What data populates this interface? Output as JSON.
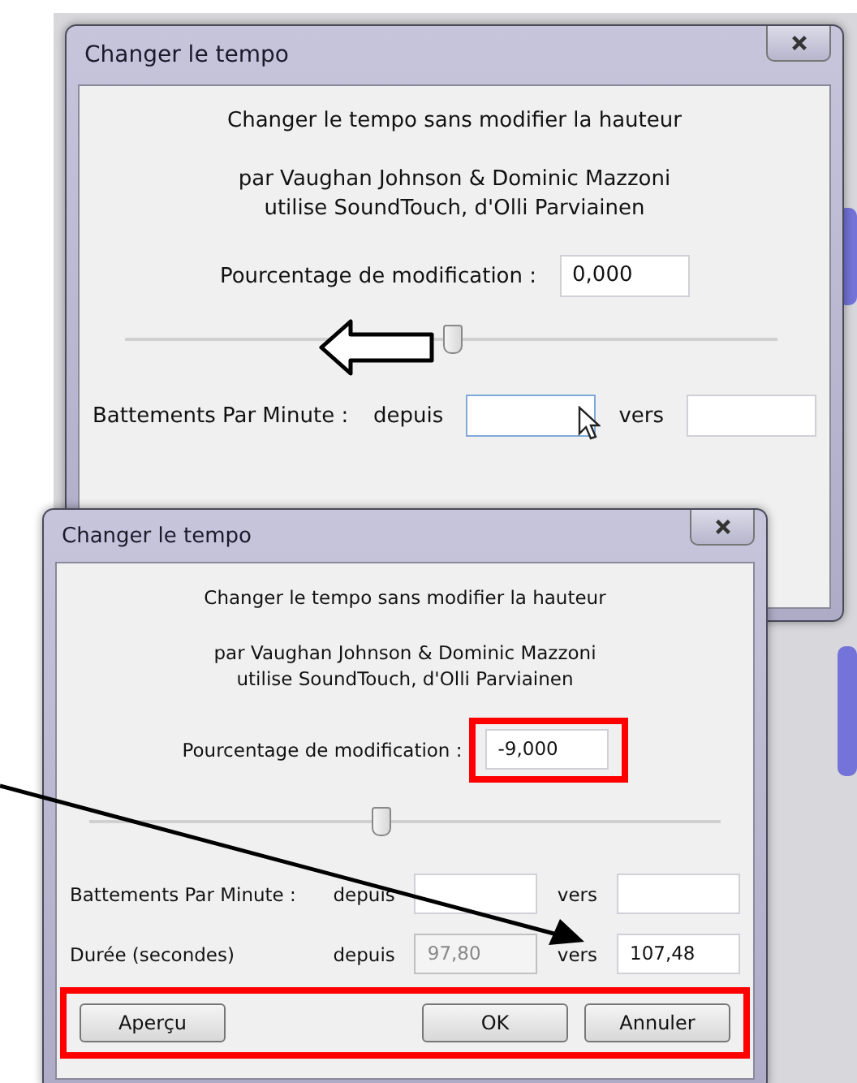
{
  "windows": [
    {
      "title": "Changer le tempo",
      "heading": "Changer le tempo sans modifier la hauteur",
      "credits": [
        "par Vaughan Johnson & Dominic Mazzoni",
        "utilise SoundTouch, d'Olli Parviainen"
      ],
      "percent": {
        "label": "Pourcentage de modification :",
        "value": "0,000",
        "highlighted": false
      },
      "slider": {
        "level": 0.5
      },
      "rows": [
        {
          "label": "Battements Par Minute :",
          "fields": [
            {
              "label": "depuis",
              "focused": true,
              "disabled": false
            },
            {
              "label": "vers",
              "focused": false,
              "disabled": false
            }
          ]
        }
      ]
    },
    {
      "title": "Changer le tempo",
      "heading": "Changer le tempo sans modifier la hauteur",
      "credits": [
        "par Vaughan Johnson & Dominic Mazzoni",
        "utilise SoundTouch, d'Olli Parviainen"
      ],
      "percent": {
        "label": "Pourcentage de modification :",
        "value": "-9,000",
        "highlighted": true
      },
      "slider": {
        "level": 0.46
      },
      "rows": [
        {
          "label": "Battements Par Minute :",
          "fields": [
            {
              "label": "depuis",
              "focused": false,
              "disabled": false
            },
            {
              "label": "vers",
              "focused": false,
              "disabled": false
            }
          ]
        },
        {
          "label": "Durée (secondes)",
          "fields": [
            {
              "label": "depuis",
              "value": "97,80",
              "focused": false,
              "disabled": true
            },
            {
              "label": "vers",
              "value": "107,48",
              "focused": false,
              "disabled": false
            }
          ]
        }
      ],
      "buttons": [
        {
          "label": "Aperçu"
        },
        {
          "label": "OK"
        },
        {
          "label": "Annuler"
        }
      ],
      "buttons_highlighted": true
    }
  ]
}
